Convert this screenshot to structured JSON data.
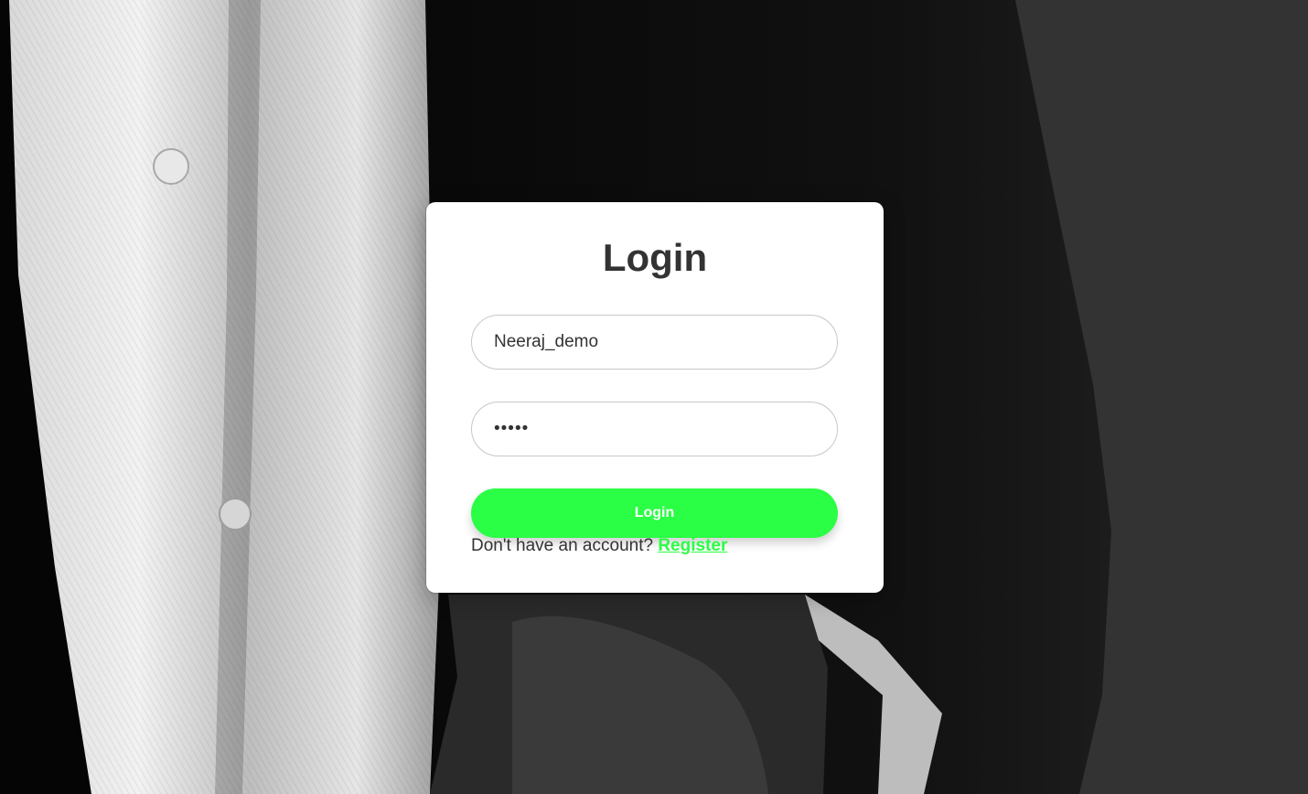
{
  "login_card": {
    "title": "Login",
    "username_value": "Neeraj_demo",
    "password_value": "•••••",
    "submit_label": "Login",
    "register_prompt": "Don't have an account?",
    "register_link": "Register"
  },
  "colors": {
    "accent": "#2afe45",
    "text": "#333333",
    "background": "#333333"
  }
}
